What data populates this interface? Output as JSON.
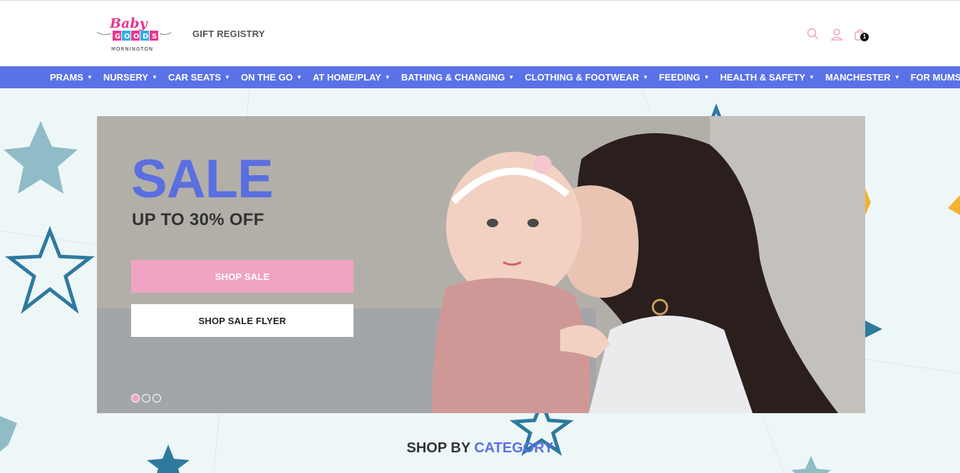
{
  "header": {
    "logo_text": "Baby GOODS MORNINGTON",
    "gift_registry": "GIFT REGISTRY",
    "cart_count": "1",
    "icons": [
      "search-icon",
      "user-icon",
      "cart-icon"
    ],
    "accent_color": "#f0a3c2"
  },
  "nav": {
    "items": [
      {
        "label": "PRAMS"
      },
      {
        "label": "NURSERY"
      },
      {
        "label": "CAR SEATS"
      },
      {
        "label": "ON THE GO"
      },
      {
        "label": "AT HOME/PLAY"
      },
      {
        "label": "BATHING & CHANGING"
      },
      {
        "label": "CLOTHING & FOOTWEAR"
      },
      {
        "label": "FEEDING"
      },
      {
        "label": "HEALTH & SAFETY"
      },
      {
        "label": "MANCHESTER"
      },
      {
        "label": "FOR MUMS"
      }
    ],
    "bg_color": "#5a72e8"
  },
  "hero": {
    "title": "SALE",
    "subtitle": "UP TO 30% OFF",
    "primary_button": "SHOP SALE",
    "secondary_button": "SHOP SALE FLYER",
    "slides": 3,
    "active_slide": 1
  },
  "section": {
    "title_part1": "SHOP BY",
    "title_part2": "CATEGORY"
  }
}
